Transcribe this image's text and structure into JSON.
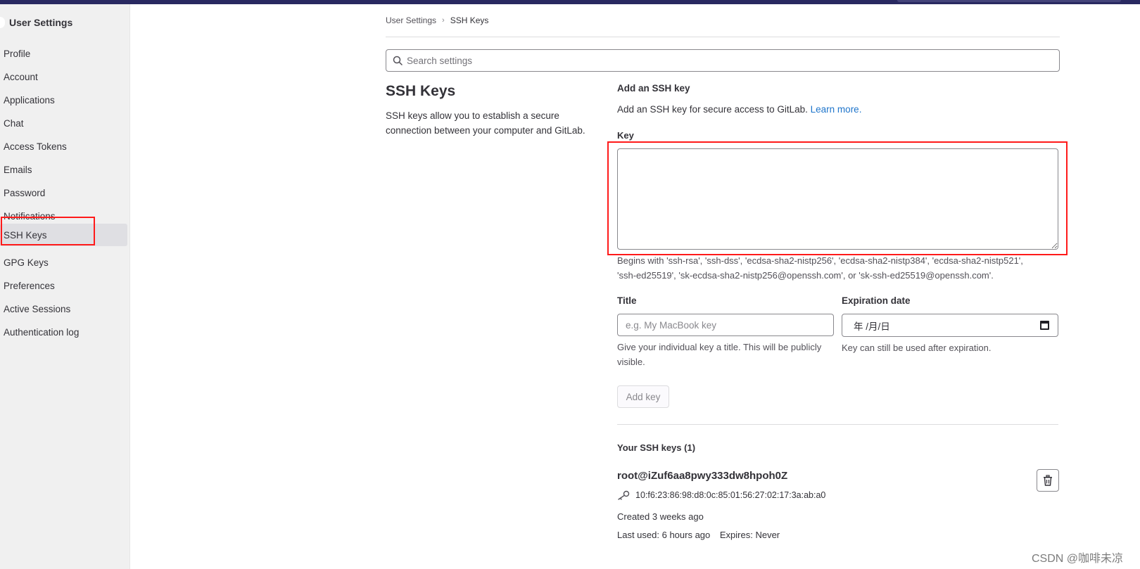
{
  "sidebar": {
    "title": "User Settings",
    "items": [
      {
        "label": "Profile"
      },
      {
        "label": "Account"
      },
      {
        "label": "Applications"
      },
      {
        "label": "Chat"
      },
      {
        "label": "Access Tokens"
      },
      {
        "label": "Emails"
      },
      {
        "label": "Password"
      },
      {
        "label": "Notifications"
      },
      {
        "label": "SSH Keys",
        "active": true
      },
      {
        "label": "GPG Keys"
      },
      {
        "label": "Preferences"
      },
      {
        "label": "Active Sessions"
      },
      {
        "label": "Authentication log"
      }
    ]
  },
  "breadcrumb": {
    "parent": "User Settings",
    "separator": "›",
    "current": "SSH Keys"
  },
  "search": {
    "placeholder": "Search settings",
    "icon": "search-icon"
  },
  "section": {
    "title": "SSH Keys",
    "description": "SSH keys allow you to establish a secure connection between your computer and GitLab."
  },
  "add_key": {
    "heading": "Add an SSH key",
    "intro": "Add an SSH key for secure access to GitLab.",
    "learn_more": "Learn more.",
    "key_label": "Key",
    "key_value": "",
    "key_help_line1": "Begins with 'ssh-rsa', 'ssh-dss', 'ecdsa-sha2-nistp256', 'ecdsa-sha2-nistp384', 'ecdsa-sha2-nistp521',",
    "key_help_line2": "'ssh-ed25519', 'sk-ecdsa-sha2-nistp256@openssh.com', or 'sk-ssh-ed25519@openssh.com'.",
    "title_label": "Title",
    "title_placeholder": "e.g. My MacBook key",
    "title_help": "Give your individual key a title. This will be publicly visible.",
    "expiration_label": "Expiration date",
    "expiration_value": "年 /月/日",
    "expiration_help": "Key can still be used after expiration.",
    "submit_label": "Add key"
  },
  "existing_keys": {
    "heading": "Your SSH keys (1)",
    "keys": [
      {
        "name": "root@iZuf6aa8pwy333dw8hpoh0Z",
        "fingerprint": "10:f6:23:86:98:d8:0c:85:01:56:27:02:17:3a:ab:a0",
        "created": "Created 3 weeks ago",
        "last_used": "Last used: 6 hours ago",
        "expires": "Expires: Never"
      }
    ]
  },
  "watermark": "CSDN @咖啡未凉",
  "colors": {
    "highlight": "#ff1a1a",
    "link": "#1f75cb",
    "topbar": "#292961"
  }
}
